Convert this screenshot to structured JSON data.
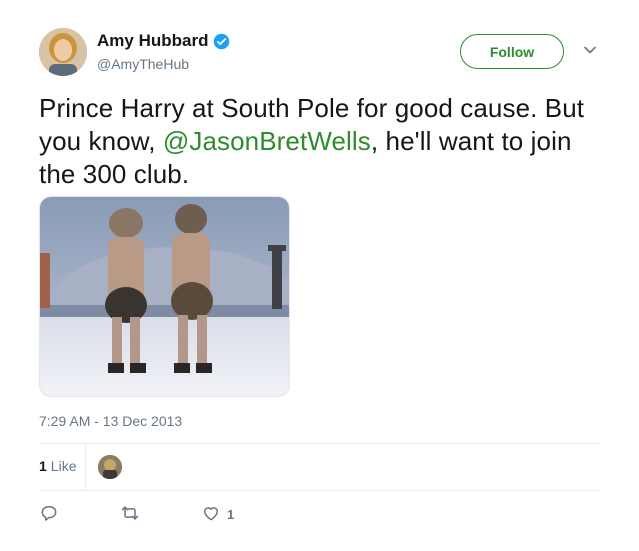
{
  "author": {
    "display_name": "Amy Hubbard",
    "handle": "@AmyTheHub",
    "verified": true
  },
  "follow_label": "Follow",
  "tweet": {
    "text_before": "Prince Harry at South Pole for good cause. But you know, ",
    "mention": "@JasonBretWells",
    "text_after": ", he'll want to join the 300 club."
  },
  "timestamp": "7:29 AM - 13 Dec 2013",
  "stats": {
    "likes_count": "1",
    "likes_label": "Like"
  },
  "actions": {
    "reply_count": "",
    "retweet_count": "",
    "like_count": "1"
  },
  "colors": {
    "accent": "#2e8b2e",
    "verified": "#1da1f2",
    "muted": "#657786"
  },
  "icons": [
    "verified-icon",
    "chevron-down-icon",
    "reply-icon",
    "retweet-icon",
    "heart-icon"
  ]
}
